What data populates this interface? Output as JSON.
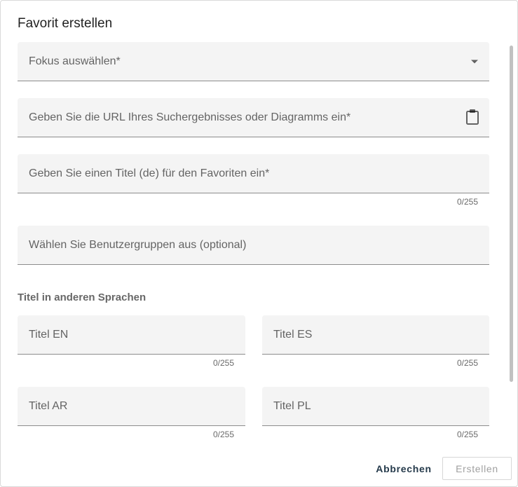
{
  "dialog": {
    "title": "Favorit erstellen",
    "fields": {
      "focus": {
        "label": "Fokus auswählen*"
      },
      "url": {
        "label": "Geben Sie die URL Ihres Suchergebnisses oder Diagramms ein*"
      },
      "title_de": {
        "label": "Geben Sie einen Titel (de) für den Favoriten ein*",
        "counter": "0/255"
      },
      "groups": {
        "label": "Wählen Sie Benutzergruppen aus (optional)"
      }
    },
    "section_title": "Titel in anderen Sprachen",
    "language_titles": {
      "en": {
        "label": "Titel EN",
        "counter": "0/255"
      },
      "es": {
        "label": "Titel ES",
        "counter": "0/255"
      },
      "ar": {
        "label": "Titel AR",
        "counter": "0/255"
      },
      "pl": {
        "label": "Titel PL",
        "counter": "0/255"
      }
    },
    "buttons": {
      "cancel": "Abbrechen",
      "create": "Erstellen"
    }
  }
}
